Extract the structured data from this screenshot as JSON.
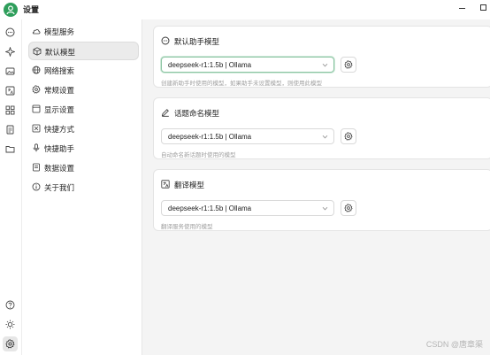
{
  "app": {
    "title": "设置"
  },
  "rail": {
    "icons": [
      "chat-icon",
      "sparkle-icon",
      "image-icon",
      "translate-icon",
      "apps-icon",
      "notes-icon",
      "folder-icon",
      "help-icon",
      "theme-icon",
      "settings-icon"
    ]
  },
  "menu": {
    "items": [
      {
        "label": "模型服务",
        "icon": "cloud-icon"
      },
      {
        "label": "默认模型",
        "icon": "cube-icon"
      },
      {
        "label": "网络搜索",
        "icon": "globe-icon"
      },
      {
        "label": "常规设置",
        "icon": "gear-icon"
      },
      {
        "label": "显示设置",
        "icon": "display-icon"
      },
      {
        "label": "快捷方式",
        "icon": "shortcut-icon"
      },
      {
        "label": "快捷助手",
        "icon": "microphone-icon"
      },
      {
        "label": "数据设置",
        "icon": "database-icon"
      },
      {
        "label": "关于我们",
        "icon": "info-icon"
      }
    ],
    "active_index": 1
  },
  "cards": [
    {
      "title": "默认助手模型",
      "icon": "chat-bubble-icon",
      "selected_model": "deepseek-r1:1.5b | Ollama",
      "description": "创建新助手时使用的模型，如果助手未设置模型，则使用此模型"
    },
    {
      "title": "话题命名模型",
      "icon": "edit-icon",
      "selected_model": "deepseek-r1:1.5b | Ollama",
      "description": "自动命名新话题时使用的模型"
    },
    {
      "title": "翻译模型",
      "icon": "translate-icon",
      "selected_model": "deepseek-r1:1.5b | Ollama",
      "description": "翻译服务使用的模型"
    }
  ],
  "watermark": "CSDN @唐章渠",
  "colors": {
    "accent": "#2e9e5b",
    "content_bg": "#f4f4f4",
    "menu_active_bg": "#ebebeb"
  }
}
